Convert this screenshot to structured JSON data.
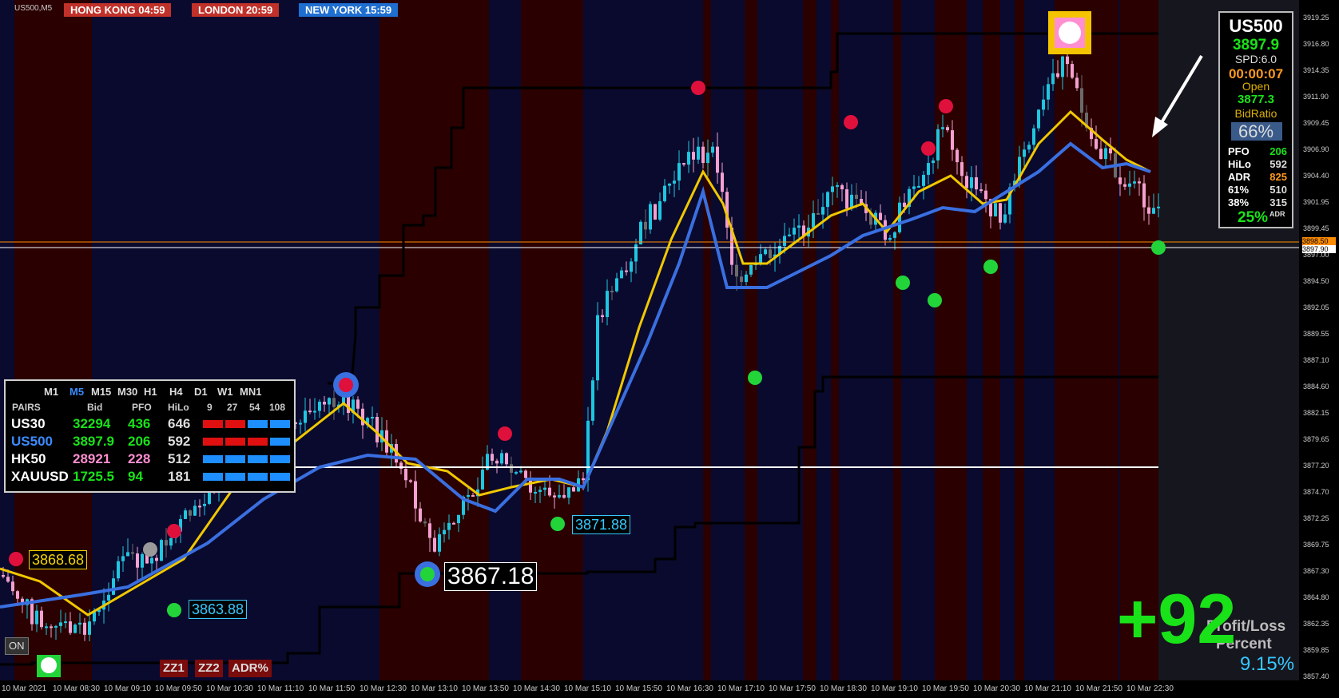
{
  "window": {
    "symbol": "US500,M5"
  },
  "sessions": [
    {
      "label": "HONG KONG 04:59",
      "color": "#c0312a"
    },
    {
      "label": "LONDON  20:59",
      "color": "#c0312a"
    },
    {
      "label": "NEW YORK  15:59",
      "color": "#1f6fd1"
    }
  ],
  "info_panel": {
    "symbol": "US500",
    "bid": "3897.9",
    "spread": "SPD:6.0",
    "countdown": "00:00:07",
    "open_label": "Open",
    "open_value": "3877.3",
    "bidratio_label": "BidRatio",
    "bidratio_value": "66%",
    "rows": [
      {
        "label": "PFO",
        "value": "206",
        "color": "#19e219"
      },
      {
        "label": "HiLo",
        "value": "592",
        "color": "#dddddd"
      },
      {
        "label": "ADR",
        "value": "825",
        "color": "#ff9a1f"
      },
      {
        "label": "61%",
        "value": "510",
        "color": "#dddddd"
      },
      {
        "label": "38%",
        "value": "315",
        "color": "#dddddd"
      }
    ],
    "adr_pct": "25%",
    "adr_sup": "ADR"
  },
  "pair_panel": {
    "timeframes": [
      "M1",
      "M5",
      "M15",
      "M30",
      "H1",
      "H4",
      "D1",
      "W1",
      "MN1"
    ],
    "active_timeframe": "M5",
    "headers": [
      "PAIRS",
      "Bid",
      "PFO",
      "HiLo",
      "9",
      "27",
      "54",
      "108"
    ],
    "rows": [
      {
        "pair": "US30",
        "bid": "32294",
        "pfo": "436",
        "hilo": "646",
        "pair_color": "#ffffff",
        "bid_color": "#19e219",
        "pfo_color": "#19e219",
        "trend": [
          "red",
          "red",
          "blue",
          "blue"
        ]
      },
      {
        "pair": "US500",
        "bid": "3897.9",
        "pfo": "206",
        "hilo": "592",
        "pair_color": "#3b8bff",
        "bid_color": "#19e219",
        "pfo_color": "#19e219",
        "trend": [
          "red",
          "red",
          "red",
          "blue"
        ]
      },
      {
        "pair": "HK50",
        "bid": "28921",
        "pfo": "228",
        "hilo": "512",
        "pair_color": "#ffffff",
        "bid_color": "#ff8fd1",
        "pfo_color": "#ff8fd1",
        "trend": [
          "blue",
          "blue",
          "blue",
          "blue"
        ]
      },
      {
        "pair": "XAUUSD",
        "bid": "1725.5",
        "pfo": "94",
        "hilo": "181",
        "pair_color": "#ffffff",
        "bid_color": "#19e219",
        "pfo_color": "#19e219",
        "trend": [
          "blue",
          "blue",
          "blue",
          "blue"
        ]
      }
    ]
  },
  "labels": {
    "l3868": "3868.68",
    "l3863": "3863.88",
    "l3867": "3867.18",
    "l3871": "3871.88",
    "on_button": "ON",
    "zz1": "ZZ1",
    "zz2": "ZZ2",
    "adr_button": "ADR%",
    "profit_big": "+92",
    "profit_title_1": "Profit/Loss",
    "profit_title_2": "Percent",
    "profit_percent": "9.15%"
  },
  "price_axis": {
    "ticks": [
      "3919.25",
      "3916.80",
      "3914.35",
      "3911.90",
      "3909.45",
      "3906.90",
      "3904.40",
      "3901.95",
      "3899.45",
      "3897.00",
      "3894.50",
      "3892.05",
      "3889.55",
      "3887.10",
      "3884.60",
      "3882.15",
      "3879.65",
      "3877.20",
      "3874.70",
      "3872.25",
      "3869.75",
      "3867.30",
      "3864.80",
      "3862.35",
      "3859.85",
      "3857.40"
    ],
    "price_tag_orange": "3898.50",
    "price_tag_white": "3897.90"
  },
  "time_axis": {
    "ticks": [
      "10 Mar 2021",
      "10 Mar 08:30",
      "10 Mar 09:10",
      "10 Mar 09:50",
      "10 Mar 10:30",
      "10 Mar 11:10",
      "10 Mar 11:50",
      "10 Mar 12:30",
      "10 Mar 13:10",
      "10 Mar 13:50",
      "10 Mar 14:30",
      "10 Mar 15:10",
      "10 Mar 15:50",
      "10 Mar 16:30",
      "10 Mar 17:10",
      "10 Mar 17:50",
      "10 Mar 18:30",
      "10 Mar 19:10",
      "10 Mar 19:50",
      "10 Mar 20:30",
      "10 Mar 21:10",
      "10 Mar 21:50",
      "10 Mar 22:30"
    ]
  },
  "colors": {
    "bg_red_zone": "#2a0000",
    "bg_blue_zone": "#0a0a2e",
    "bull_candle": "#1fc6e0",
    "bear_candle": "#f4a0d0",
    "neutral_candle": "#6a6a6a",
    "ma_fast": "#f0c800",
    "ma_slow": "#3a6fe0"
  }
}
